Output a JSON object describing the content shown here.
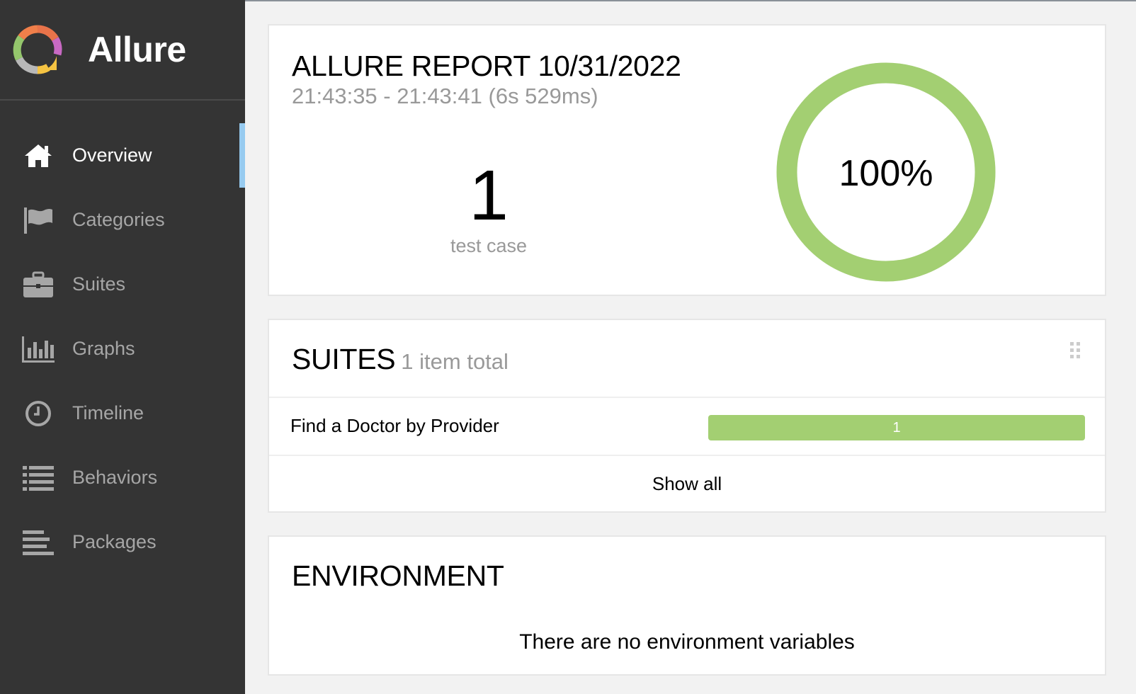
{
  "brand": {
    "name": "Allure"
  },
  "nav": [
    {
      "label": "Overview",
      "icon": "home-icon",
      "active": true
    },
    {
      "label": "Categories",
      "icon": "flag-icon",
      "active": false
    },
    {
      "label": "Suites",
      "icon": "briefcase-icon",
      "active": false
    },
    {
      "label": "Graphs",
      "icon": "bar-chart-icon",
      "active": false
    },
    {
      "label": "Timeline",
      "icon": "clock-icon",
      "active": false
    },
    {
      "label": "Behaviors",
      "icon": "list-icon",
      "active": false
    },
    {
      "label": "Packages",
      "icon": "align-left-icon",
      "active": false
    }
  ],
  "summary": {
    "title": "ALLURE REPORT 10/31/2022",
    "time_range": "21:43:35 - 21:43:41 (6s 529ms)",
    "test_count": "1",
    "test_count_label": "test case",
    "pass_percent": "100%",
    "pass_fraction": 1.0
  },
  "suites": {
    "title": "SUITES",
    "subtitle": "1 item total",
    "items": [
      {
        "name": "Find a Doctor by Provider",
        "passed": "1",
        "passed_fraction": 1.0
      }
    ],
    "show_all_label": "Show all"
  },
  "environment": {
    "title": "ENVIRONMENT",
    "empty_message": "There are no environment variables"
  },
  "colors": {
    "sidebar_bg": "#343434",
    "active_indicator": "#97cbf0",
    "passed_green": "#a3cf72"
  }
}
